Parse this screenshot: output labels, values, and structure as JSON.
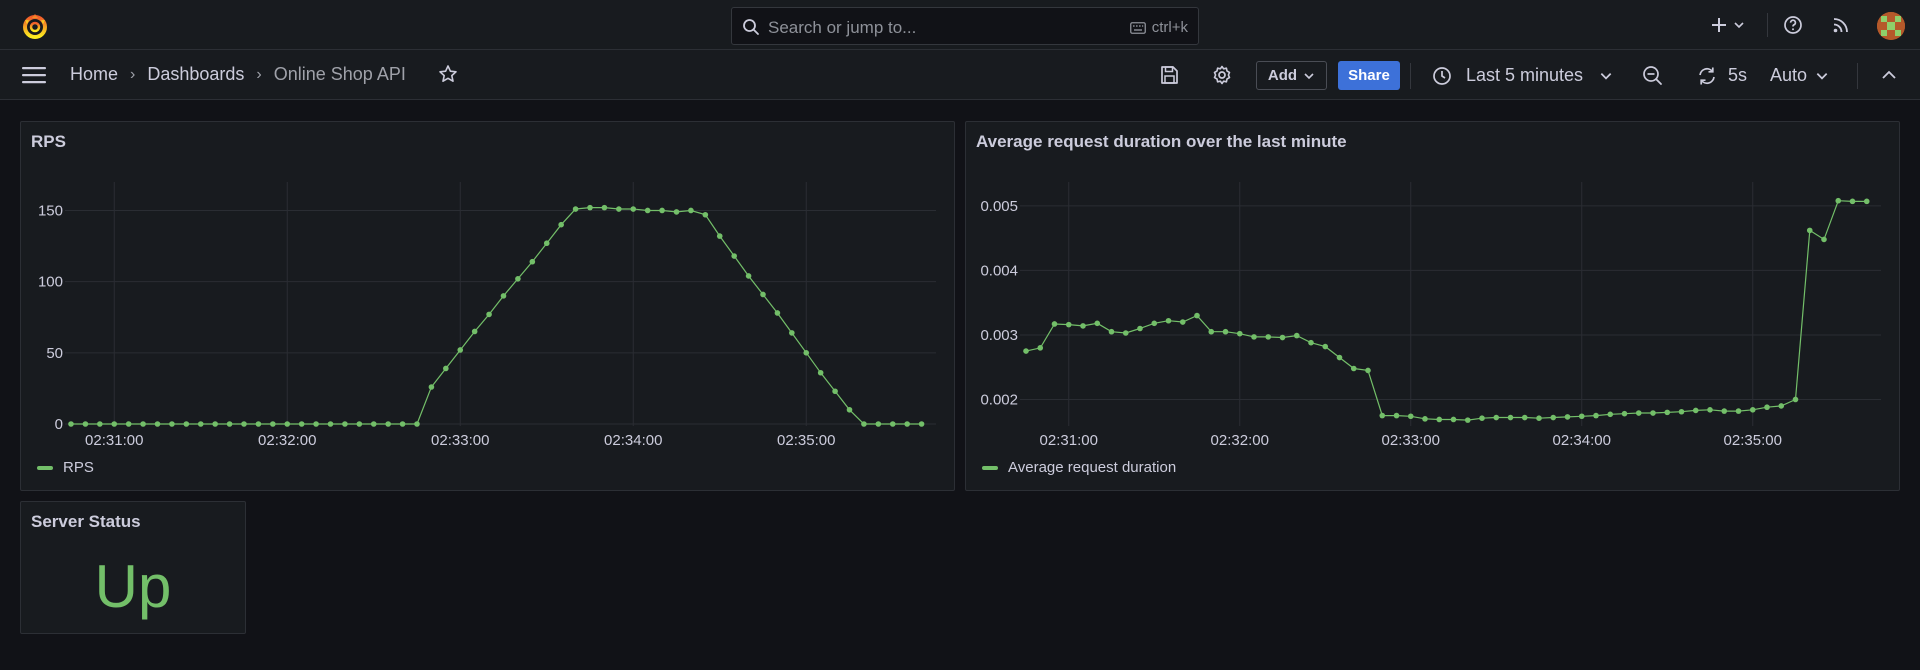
{
  "topbar": {
    "search_placeholder": "Search or jump to...",
    "search_shortcut": "ctrl+k"
  },
  "breadcrumb": {
    "home": "Home",
    "dashboards": "Dashboards",
    "current": "Online Shop API"
  },
  "toolbar": {
    "add_label": "Add",
    "share_label": "Share",
    "time_range": "Last 5 minutes",
    "refresh_interval": "5s",
    "refresh_mode": "Auto"
  },
  "colors": {
    "series": "#73bf69",
    "share": "#3d71d9",
    "background": "#111217",
    "panel": "#181b1f"
  },
  "panels": {
    "rps": {
      "title": "RPS",
      "legend": "RPS"
    },
    "duration": {
      "title": "Average request duration over the last minute",
      "legend": "Average request duration"
    },
    "status": {
      "title": "Server Status",
      "value": "Up"
    }
  },
  "chart_data": [
    {
      "type": "line",
      "title": "RPS",
      "x_tick_labels": [
        "02:31:00",
        "02:32:00",
        "02:33:00",
        "02:34:00",
        "02:35:00"
      ],
      "x_tick_seconds": [
        60,
        120,
        180,
        240,
        300
      ],
      "y_ticks": [
        0,
        50,
        100,
        150
      ],
      "ylim": [
        0,
        170
      ],
      "xlim": [
        45,
        345
      ],
      "grid": true,
      "legend_position": "bottom-left",
      "series": [
        {
          "name": "RPS",
          "x": [
            45,
            50,
            55,
            60,
            65,
            70,
            75,
            80,
            85,
            90,
            95,
            100,
            105,
            110,
            115,
            120,
            125,
            130,
            135,
            140,
            145,
            150,
            155,
            160,
            165,
            170,
            175,
            180,
            185,
            190,
            195,
            200,
            205,
            210,
            215,
            220,
            225,
            230,
            235,
            240,
            245,
            250,
            255,
            260,
            265,
            270,
            275,
            280,
            285,
            290,
            295,
            300,
            305,
            310,
            315,
            320,
            325,
            330,
            335,
            340
          ],
          "values": [
            0,
            0,
            0,
            0,
            0,
            0,
            0,
            0,
            0,
            0,
            0,
            0,
            0,
            0,
            0,
            0,
            0,
            0,
            0,
            0,
            0,
            0,
            0,
            0,
            0,
            26,
            39,
            52,
            65,
            77,
            90,
            102,
            114,
            127,
            140,
            151,
            152,
            152,
            151,
            151,
            150,
            150,
            149,
            150,
            147,
            132,
            118,
            104,
            91,
            78,
            64,
            50,
            36,
            23,
            10,
            0,
            0,
            0,
            0,
            0
          ]
        }
      ]
    },
    {
      "type": "line",
      "title": "Average request duration over the last minute",
      "x_tick_labels": [
        "02:31:00",
        "02:32:00",
        "02:33:00",
        "02:34:00",
        "02:35:00"
      ],
      "x_tick_seconds": [
        60,
        120,
        180,
        240,
        300
      ],
      "y_ticks": [
        0.002,
        0.003,
        0.004,
        0.005
      ],
      "ylim": [
        0.00162,
        0.00537
      ],
      "xlim": [
        45,
        345
      ],
      "grid": true,
      "legend_position": "bottom-left",
      "series": [
        {
          "name": "Average request duration",
          "x": [
            45,
            50,
            55,
            60,
            65,
            70,
            75,
            80,
            85,
            90,
            95,
            100,
            105,
            110,
            115,
            120,
            125,
            130,
            135,
            140,
            145,
            150,
            155,
            160,
            165,
            170,
            175,
            180,
            185,
            190,
            195,
            200,
            205,
            210,
            215,
            220,
            225,
            230,
            235,
            240,
            245,
            250,
            255,
            260,
            265,
            270,
            275,
            280,
            285,
            290,
            295,
            300,
            305,
            310,
            315,
            320,
            325,
            330,
            335,
            340
          ],
          "values": [
            0.00275,
            0.0028,
            0.00317,
            0.00316,
            0.00314,
            0.00318,
            0.00305,
            0.00303,
            0.0031,
            0.00318,
            0.00322,
            0.0032,
            0.0033,
            0.00305,
            0.00305,
            0.00302,
            0.00297,
            0.00297,
            0.00296,
            0.00299,
            0.00288,
            0.00282,
            0.00265,
            0.00248,
            0.00245,
            0.00175,
            0.00175,
            0.00174,
            0.0017,
            0.00169,
            0.00169,
            0.00168,
            0.00171,
            0.00172,
            0.00172,
            0.00172,
            0.00171,
            0.00172,
            0.00173,
            0.00174,
            0.00175,
            0.00177,
            0.00178,
            0.00179,
            0.00179,
            0.0018,
            0.00181,
            0.00183,
            0.00184,
            0.00182,
            0.00182,
            0.00184,
            0.00188,
            0.0019,
            0.002,
            0.00462,
            0.00448,
            0.00508,
            0.00507,
            0.00507
          ]
        }
      ]
    }
  ]
}
